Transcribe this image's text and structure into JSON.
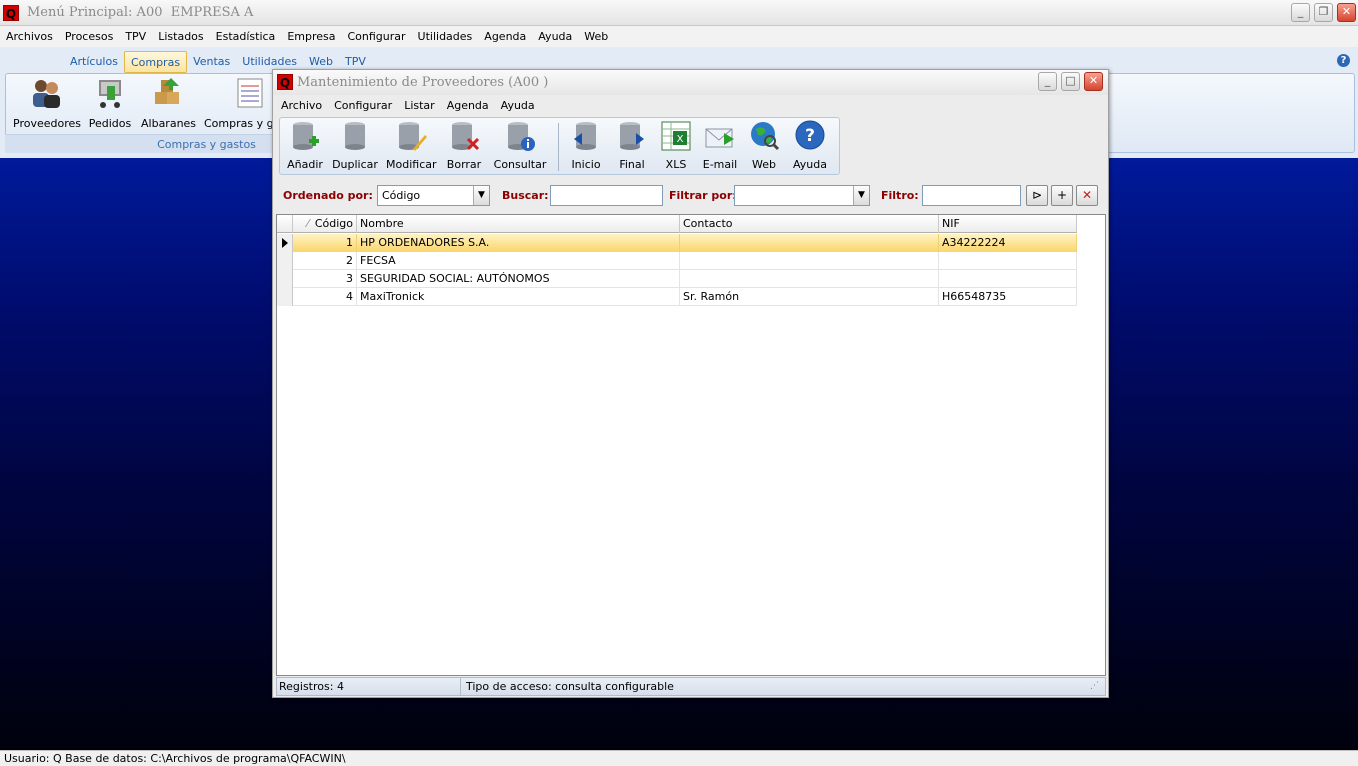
{
  "main_window": {
    "title": "Menú Principal: A00  EMPRESA A",
    "menu": [
      "Archivos",
      "Procesos",
      "TPV",
      "Listados",
      "Estadística",
      "Empresa",
      "Configurar",
      "Utilidades",
      "Agenda",
      "Ayuda",
      "Web"
    ]
  },
  "ribbon": {
    "tabs": [
      "Artículos",
      "Compras",
      "Ventas",
      "Utilidades",
      "Web",
      "TPV"
    ],
    "active_tab": "Compras",
    "buttons": [
      "Proveedores",
      "Pedidos",
      "Albaranes",
      "Compras y gastos"
    ],
    "group_label": "Compras y gastos"
  },
  "child_window": {
    "title": "Mantenimiento de Proveedores (A00 )",
    "menu": [
      "Archivo",
      "Configurar",
      "Listar",
      "Agenda",
      "Ayuda"
    ],
    "toolbar": [
      "Añadir",
      "Duplicar",
      "Modificar",
      "Borrar",
      "Consultar",
      "Inicio",
      "Final",
      "XLS",
      "E-mail",
      "Web",
      "Ayuda"
    ],
    "filters": {
      "order_label": "Ordenado por:",
      "order_value": "Código",
      "search_label": "Buscar:",
      "search_value": "",
      "filter_by_label": "Filtrar por:",
      "filter_by_value": "",
      "filter_label": "Filtro:",
      "filter_value": ""
    },
    "grid": {
      "columns": [
        "Código",
        "Nombre",
        "Contacto",
        "NIF"
      ],
      "rows": [
        {
          "codigo": "1",
          "nombre": "HP ORDENADORES S.A.",
          "contacto": "",
          "nif": "A34222224"
        },
        {
          "codigo": "2",
          "nombre": "FECSA",
          "contacto": "",
          "nif": ""
        },
        {
          "codigo": "3",
          "nombre": "SEGURIDAD SOCIAL: AUTÓNOMOS",
          "contacto": "",
          "nif": ""
        },
        {
          "codigo": "4",
          "nombre": "MaxiTronick",
          "contacto": "Sr. Ramón",
          "nif": "H66548735"
        }
      ],
      "selected_row": 0
    },
    "status": {
      "records": "Registros: 4",
      "access": "Tipo de acceso: consulta configurable"
    }
  },
  "bottom_status": "Usuario: Q  Base de datos: C:\\Archivos de programa\\QFACWIN\\",
  "colors": {
    "accent_blue": "#1e5da8",
    "label_red": "#8b0000",
    "selection": "#fbd56b",
    "desktop_top": "#001a9a"
  }
}
